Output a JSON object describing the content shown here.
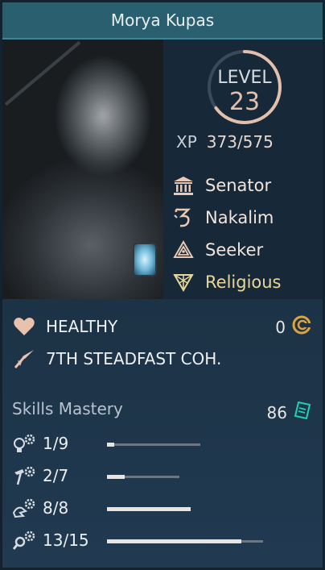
{
  "character": {
    "name": "Morya Kupas",
    "level_label": "LEVEL",
    "level": "23",
    "xp_label": "XP",
    "xp": "373/575",
    "xp_current": 373,
    "xp_max": 575
  },
  "traits": [
    {
      "label": "Senator",
      "icon": "senate-building-icon"
    },
    {
      "label": "Nakalim",
      "icon": "nakalim-glyph-icon"
    },
    {
      "label": "Seeker",
      "icon": "seeker-triangle-icon"
    },
    {
      "label": "Religious",
      "icon": "religious-triangle-icon"
    }
  ],
  "status": {
    "health": "HEALTHY",
    "health_icon": "heart-icon",
    "influence": "0",
    "influence_icon": "influence-spiral-icon",
    "unit": "7TH STEADFAST COH.",
    "unit_icon": "spear-arrow-icon"
  },
  "skills": {
    "title": "Skills Mastery",
    "total": "86",
    "total_icon": "mastery-scroll-icon",
    "items": [
      {
        "value": "1/9",
        "icon": "gear-bulb-icon",
        "fraction": 0.08
      },
      {
        "value": "2/7",
        "icon": "gear-hammer-icon",
        "fraction": 0.24
      },
      {
        "value": "8/8",
        "icon": "gear-hand-icon",
        "fraction": 1.0
      },
      {
        "value": "13/15",
        "icon": "gear-magnifier-icon",
        "fraction": 0.86
      }
    ]
  },
  "colors": {
    "title_bar": "#2a5f6f",
    "level_number": "#e2c0ac",
    "ring": "#e2c0ac",
    "religious": "#e8d79a",
    "scroll_icon": "#1fd3b0",
    "influence_icon": "#d9a441"
  }
}
